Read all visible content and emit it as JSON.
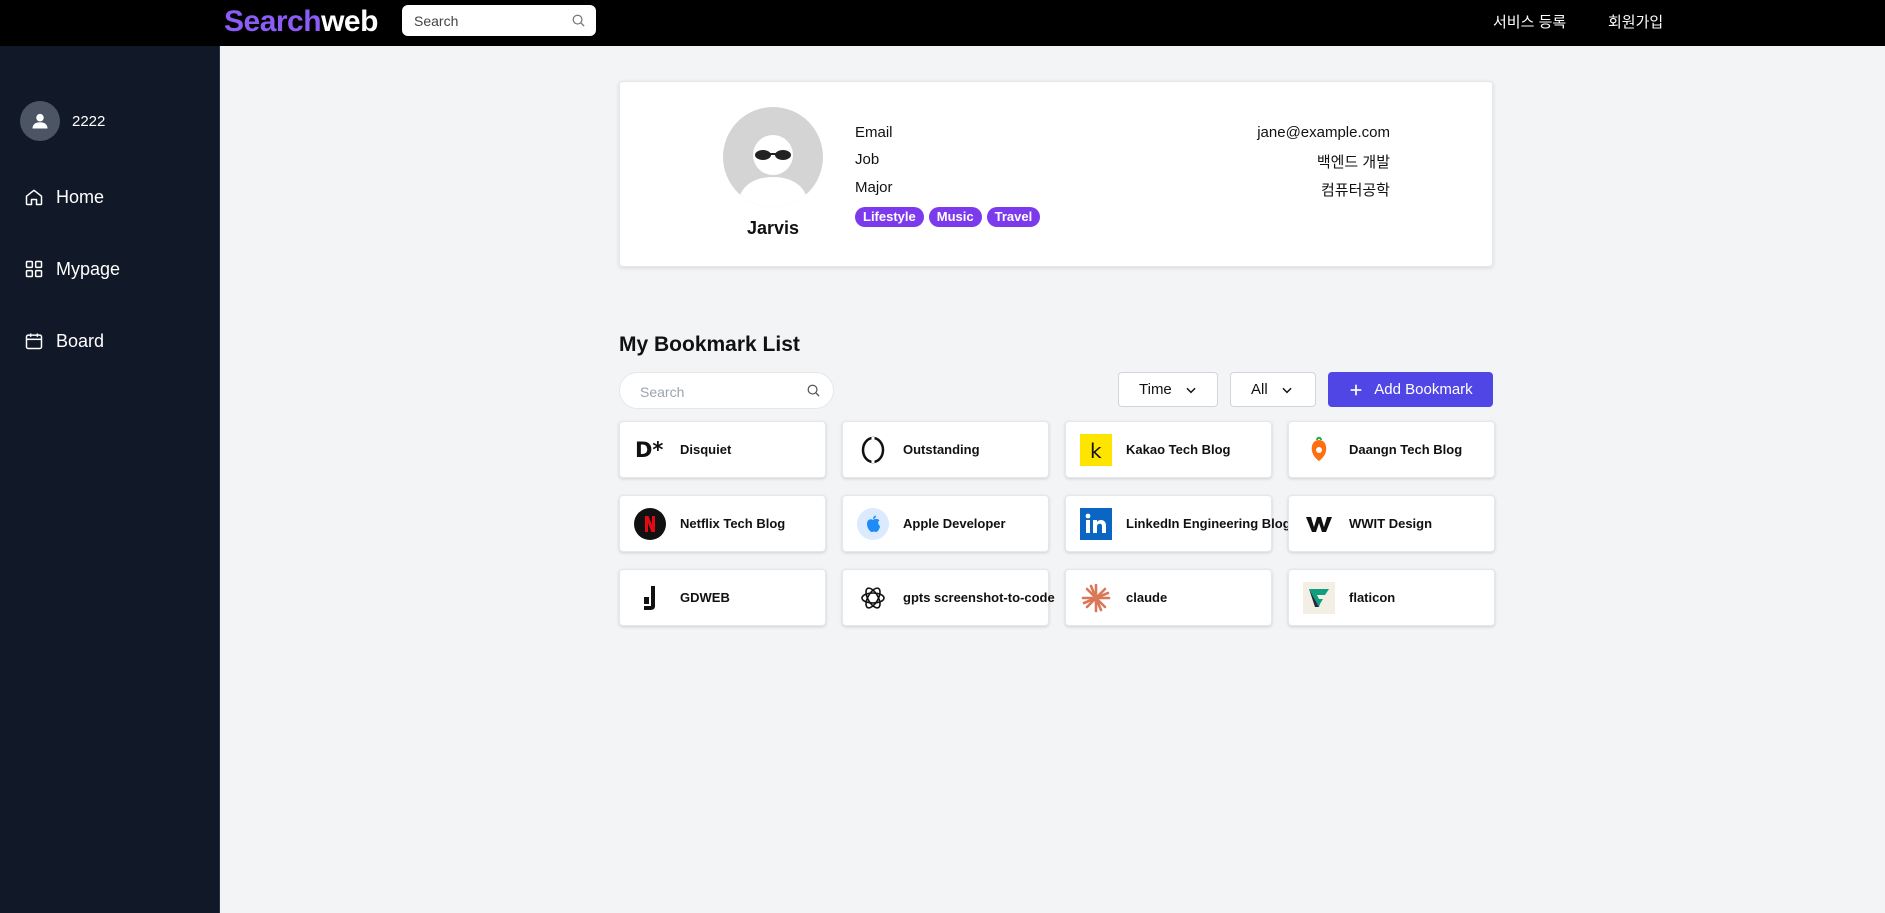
{
  "header": {
    "logo_part1": "Search",
    "logo_part2": "web",
    "search_placeholder": "Search",
    "links": [
      "서비스 등록",
      "회원가입"
    ]
  },
  "sidebar": {
    "user_name": "2222",
    "items": [
      {
        "label": "Home",
        "icon": "home-icon"
      },
      {
        "label": "Mypage",
        "icon": "grid-icon"
      },
      {
        "label": "Board",
        "icon": "calendar-icon"
      }
    ]
  },
  "profile": {
    "name": "Jarvis",
    "fields": [
      {
        "label": "Email",
        "value": "jane@example.com"
      },
      {
        "label": "Job",
        "value": "백엔드 개발"
      },
      {
        "label": "Major",
        "value": "컴퓨터공학"
      }
    ],
    "tags": [
      "Lifestyle",
      "Music",
      "Travel"
    ]
  },
  "bookmarks": {
    "title": "My Bookmark List",
    "search_placeholder": "Search",
    "sort_value": "Time",
    "filter_value": "All",
    "add_label": "Add Bookmark",
    "items": [
      {
        "name": "Disquiet",
        "icon": "disquiet-logo-icon"
      },
      {
        "name": "Outstanding",
        "icon": "outstanding-logo-icon"
      },
      {
        "name": "Kakao Tech Blog",
        "icon": "kakao-logo-icon"
      },
      {
        "name": "Daangn Tech Blog",
        "icon": "daangn-logo-icon"
      },
      {
        "name": "Netflix Tech Blog",
        "icon": "netflix-logo-icon"
      },
      {
        "name": "Apple Developer",
        "icon": "apple-logo-icon"
      },
      {
        "name": "LinkedIn Engineering Blog",
        "icon": "linkedin-logo-icon"
      },
      {
        "name": "WWIT Design",
        "icon": "wwit-logo-icon"
      },
      {
        "name": "GDWEB",
        "icon": "gdweb-logo-icon"
      },
      {
        "name": "gpts screenshot-to-code",
        "icon": "openai-logo-icon"
      },
      {
        "name": "claude",
        "icon": "claude-logo-icon"
      },
      {
        "name": "flaticon",
        "icon": "flaticon-logo-icon"
      }
    ]
  },
  "colors": {
    "accent": "#4f46e5",
    "tag": "#7c3aed",
    "logo_purple": "#8b5cf6",
    "sidebar_bg": "#111827"
  }
}
